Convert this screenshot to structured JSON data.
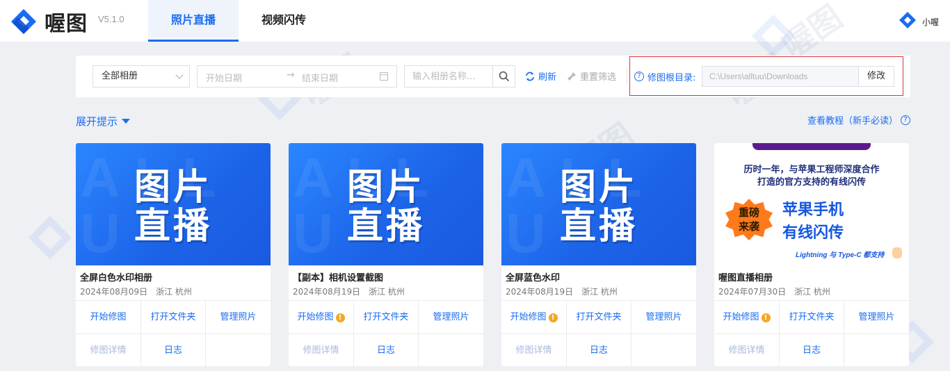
{
  "app": {
    "logo_text": "喔图",
    "version": "V5.1.0",
    "brand_color": "#1a6df0"
  },
  "header": {
    "tabs": [
      {
        "label": "照片直播",
        "active": true
      },
      {
        "label": "视频闪传",
        "active": false
      }
    ],
    "user_name": "小喔"
  },
  "filters": {
    "album_select": "全部相册",
    "date_start_placeholder": "开始日期",
    "date_sep": "→",
    "date_end_placeholder": "结束日期",
    "search_placeholder": "输入相册名称...",
    "refresh_label": "刷新",
    "reset_label": "重置筛选",
    "root_dir_label": "修图根目录:",
    "root_dir_path": "C:\\Users\\alltuu\\Downloads",
    "modify_label": "修改"
  },
  "hint": {
    "expand_label": "展开提示",
    "tutorial_label": "查看教程（新手必读）"
  },
  "cover": {
    "line1": "图片",
    "line2": "直播",
    "bg_letters": "ALL U"
  },
  "promo": {
    "line1": "历时一年，与苹果工程师深度合作",
    "line2": "打造的官方支持的有线闪传",
    "badge_line1": "重磅",
    "badge_line2": "来袭",
    "head1": "苹果手机",
    "head2": "有线闪传",
    "foot": "Lightning 与 Type-C 都支持"
  },
  "albums": [
    {
      "title": "全屏白色水印相册",
      "date": "2024年08月09日",
      "location": "浙江 杭州",
      "warn": false
    },
    {
      "title": "【副本】相机设置截图",
      "date": "2024年08月19日",
      "location": "浙江 杭州",
      "warn": true
    },
    {
      "title": "全屏蓝色水印",
      "date": "2024年08月19日",
      "location": "浙江 杭州",
      "warn": true
    },
    {
      "title": "喔图直播相册",
      "date": "2024年07月30日",
      "location": "浙江 杭州",
      "warn": true
    }
  ],
  "card_actions": {
    "start_edit": "开始修图",
    "open_folder": "打开文件夹",
    "manage_photos": "管理照片",
    "edit_details": "修图详情",
    "log": "日志"
  },
  "watermark_text": "喔图"
}
